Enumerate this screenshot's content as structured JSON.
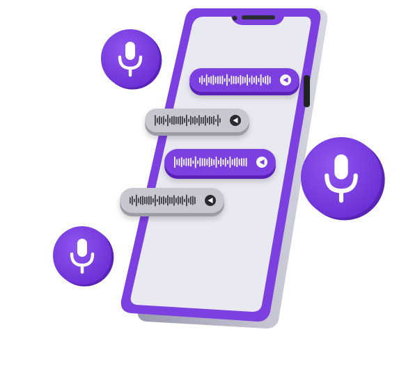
{
  "colors": {
    "accent": "#7c3fe0",
    "accent_dark": "#5a23b8",
    "screen": "#e9e9f1",
    "gray_bubble": "#c7c7cf",
    "wave_dark": "#3c3c44",
    "white": "#ffffff"
  },
  "icons": {
    "mic": "microphone-icon",
    "play": "play-triangle-icon"
  },
  "bubbles": [
    {
      "style": "purple",
      "name": "voice-message-1"
    },
    {
      "style": "gray",
      "name": "voice-message-2"
    },
    {
      "style": "purple",
      "name": "voice-message-3"
    },
    {
      "style": "gray",
      "name": "voice-message-4"
    }
  ],
  "mic_buttons": [
    {
      "name": "mic-button-top-left"
    },
    {
      "name": "mic-button-right"
    },
    {
      "name": "mic-button-bottom-left"
    }
  ]
}
